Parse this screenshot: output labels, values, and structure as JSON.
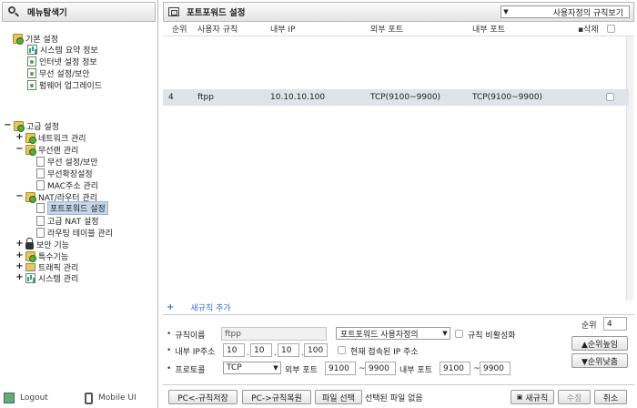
{
  "menu_panel": {
    "title": "메뉴탐색기",
    "sections": [
      {
        "label": "기본 설정",
        "items": [
          "시스템 요약 정보",
          "인터넷 설정 정보",
          "무선 설정/보안",
          "펌웨어 업그레이드"
        ]
      },
      {
        "label": "고급 설정",
        "groups": [
          {
            "toggle": "+",
            "label": "네트워크 관리"
          },
          {
            "toggle": "−",
            "label": "무선랜 관리",
            "children": [
              "무선 설정/보안",
              "무선확장설정",
              "MAC주소 관리"
            ]
          },
          {
            "toggle": "−",
            "label": "NAT/라우터 관리",
            "children": [
              "포트포워드 설정",
              "고급 NAT 설정",
              "라우팅 테이블 관리"
            ]
          },
          {
            "toggle": "+",
            "label": "보안 기능"
          },
          {
            "toggle": "+",
            "label": "특수기능"
          },
          {
            "toggle": "+",
            "label": "트래픽 관리"
          },
          {
            "toggle": "+",
            "label": "시스템 관리"
          }
        ]
      }
    ],
    "toggles": {
      "basic": "−",
      "advanced": "−"
    },
    "footer": {
      "logout": "Logout",
      "mobile": "Mobile UI"
    }
  },
  "main_panel": {
    "title": "포트포워드 설정",
    "view_select": "사용자정의 규칙보기",
    "columns": {
      "order": "순위",
      "rule": "사용자 규칙",
      "ip": "내부 IP",
      "ext_port": "외부 포트",
      "int_port": "내부 포트",
      "delete": "삭제"
    },
    "rows": [
      {
        "order": "4",
        "rule": "ftpp",
        "ip": "10.10.10.100",
        "ext_port": "TCP(9100~9900)",
        "int_port": "TCP(9100~9900)"
      }
    ],
    "add_rule": {
      "plus": "+",
      "label": "새규칙 추가"
    }
  },
  "form": {
    "rule_name_label": "규칙이름",
    "rule_name_value": "ftpp",
    "rule_type_select": "포트포워드 사용자정의",
    "disable_label": "규칙 비활성화",
    "ip_label": "내부 IP주소",
    "ip": [
      "10",
      "10",
      "10",
      "100"
    ],
    "current_ip_label": "현재 접속된 IP 주소",
    "protocol_label": "프로토콜",
    "protocol_value": "TCP",
    "ext_port_label": "외부 포트",
    "ext_port_from": "9100",
    "ext_port_to": "9900",
    "int_port_label": "내부 포트",
    "int_port_from": "9100",
    "int_port_to": "9900",
    "tilde": "~",
    "priority_label": "순위",
    "priority_value": "4",
    "priority_up": "▲순위높임",
    "priority_down": "▼순위낮춤"
  },
  "bottom": {
    "save_btn": "PC<-규칙저장",
    "restore_btn": "PC->규칙복원",
    "file_btn": "파일 선택",
    "file_status": "선택된 파일 없음",
    "new_rule_btn": "새규칙",
    "edit_btn": "수정",
    "cancel_btn": "취소"
  }
}
